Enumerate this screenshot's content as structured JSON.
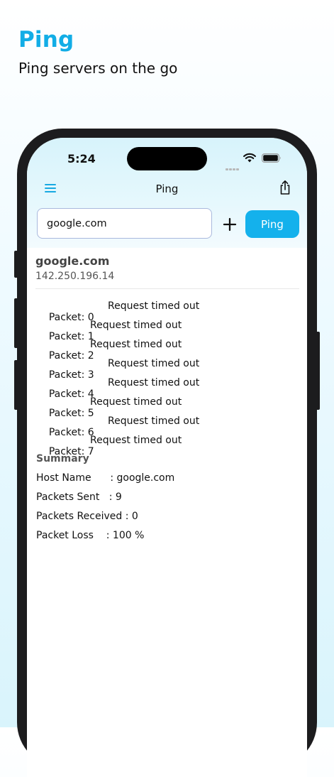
{
  "promo": {
    "title": "Ping",
    "subtitle": "Ping servers on the go"
  },
  "status_bar": {
    "time": "5:24",
    "icons": [
      "cellular-dots-icon",
      "wifi-icon",
      "battery-icon"
    ]
  },
  "nav": {
    "title": "Ping",
    "left_icon": "menu-icon",
    "right_icon": "share-icon"
  },
  "input": {
    "value": "google.com",
    "placeholder": ""
  },
  "buttons": {
    "add_symbol": "+",
    "ping_label": "Ping"
  },
  "result": {
    "host": "google.com",
    "ip": "142.250.196.14",
    "packets": [
      {
        "label": "Packet: 0",
        "status": "Request timed out"
      },
      {
        "label": "Packet: 1",
        "status": "Request timed out"
      },
      {
        "label": "Packet: 2",
        "status": "Request timed out"
      },
      {
        "label": "Packet: 3",
        "status": "Request timed out"
      },
      {
        "label": "Packet: 4",
        "status": "Request timed out"
      },
      {
        "label": "Packet: 5",
        "status": "Request timed out"
      },
      {
        "label": "Packet: 6",
        "status": "Request timed out"
      },
      {
        "label": "Packet: 7",
        "status": "Request timed out"
      }
    ],
    "summary": {
      "heading": "Summary",
      "host_name": "Host Name      : google.com",
      "packets_sent": "Packets Sent   : 9",
      "packets_received": "Packets Received : 0",
      "packet_loss": "Packet Loss    : 100 %"
    }
  },
  "colors": {
    "accent": "#14b1ec",
    "promo_title": "#12ade6",
    "phone_frame": "#1c1c1e"
  }
}
